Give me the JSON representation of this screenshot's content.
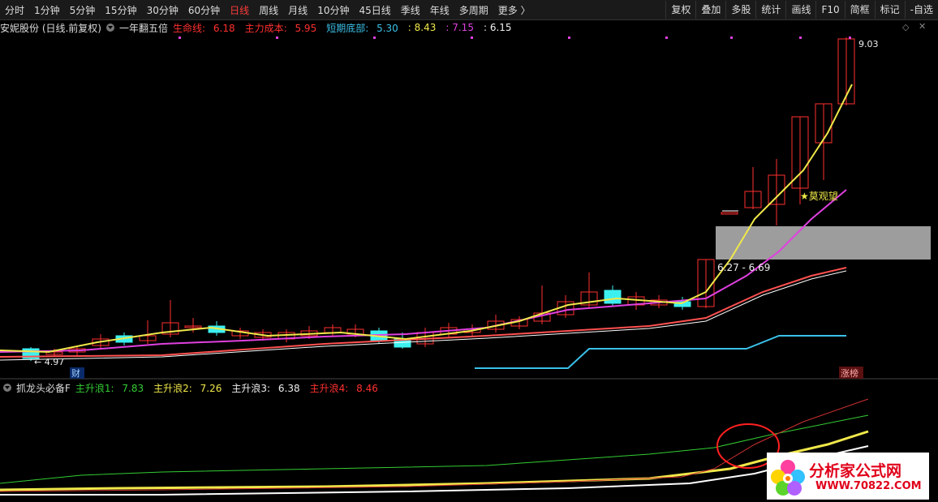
{
  "toolbar": {
    "periods": [
      "分时",
      "1分钟",
      "5分钟",
      "15分钟",
      "30分钟",
      "60分钟",
      "日线",
      "周线",
      "月线",
      "10分钟",
      "45日线",
      "季线",
      "年线",
      "多周期",
      "更多 〉"
    ],
    "active": "日线",
    "buttons": [
      "复权",
      "叠加",
      "多股",
      "统计",
      "画线",
      "F10",
      "简框",
      "标记",
      "-自选"
    ]
  },
  "main_header": {
    "stock": "安妮股份 (日线.前复权)",
    "indicator": "一年翻五倍",
    "life_line_label": "生命线:",
    "life_line_value": "6.18",
    "cost_label": "主力成本:",
    "cost_value": "5.95",
    "bottom_label": "短期底部:",
    "bottom_value": "5.30",
    "v2": "8.43",
    "v3": "7.15",
    "v4": "6.15"
  },
  "annotations": {
    "high": "9.03",
    "low": "4.97",
    "range": "6.27 - 6.69",
    "watch": "★莫观望",
    "zhangting": "涨榜",
    "cai": "财"
  },
  "sub_header": {
    "indicator": "抓龙头必备F",
    "w1_label": "主升浪1:",
    "w1_value": "7.83",
    "w2_label": "主升浪2:",
    "w2_value": "7.26",
    "w3_label": "主升浪3:",
    "w3_value": "6.38",
    "w4_label": "主升浪4:",
    "w4_value": "8.46"
  },
  "logo": {
    "line1": "分析家公式网",
    "line2": "WWW.70822.COM"
  },
  "colors": {
    "up": "#ff3030",
    "down": "#3df0f0",
    "yellow": "#f0e84a",
    "magenta": "#e040e0",
    "cyan": "#3ac0e8",
    "green": "#33cc33"
  }
}
